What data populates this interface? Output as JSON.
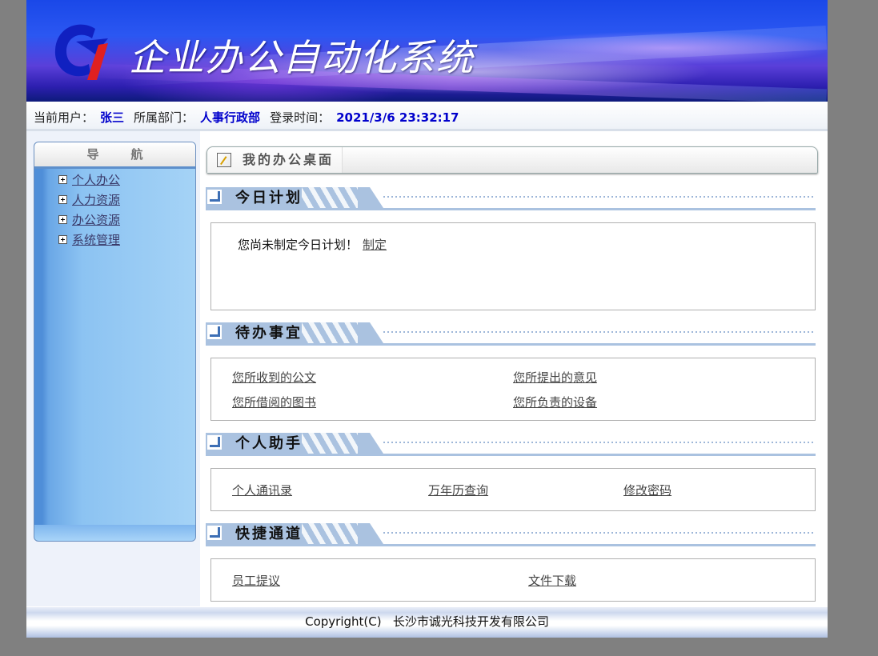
{
  "header": {
    "title": "企业办公自动化系统"
  },
  "userinfo": {
    "user_label": "当前用户：",
    "user_name": "张三",
    "dept_label": "所属部门：",
    "dept_name": "人事行政部",
    "login_label": "登录时间：",
    "login_time": "2021/3/6 23:32:17"
  },
  "nav": {
    "title": "导航",
    "items": [
      {
        "label": "个人办公"
      },
      {
        "label": "人力资源"
      },
      {
        "label": "办公资源"
      },
      {
        "label": "系统管理"
      }
    ]
  },
  "desk": {
    "tab_label": "我的办公桌面"
  },
  "today_plan": {
    "title": "今日计划",
    "message": "您尚未制定今日计划！",
    "link": "制定"
  },
  "todo": {
    "title": "待办事宜",
    "links": [
      "您所收到的公文",
      "您所提出的意见",
      "您所借阅的图书",
      "您所负责的设备"
    ]
  },
  "assistant": {
    "title": "个人助手",
    "links": [
      "个人通讯录",
      "万年历查询",
      "修改密码"
    ]
  },
  "shortcut": {
    "title": "快捷通道",
    "links": [
      "员工提议",
      "文件下载"
    ]
  },
  "footer": {
    "copyright": "Copyright(C)   长沙市诚光科技开发有限公司"
  },
  "colors": {
    "value_blue": "#0000cc",
    "section_band": "#aac2e0",
    "logo_blue": "#1020c0",
    "logo_red": "#e02020"
  }
}
